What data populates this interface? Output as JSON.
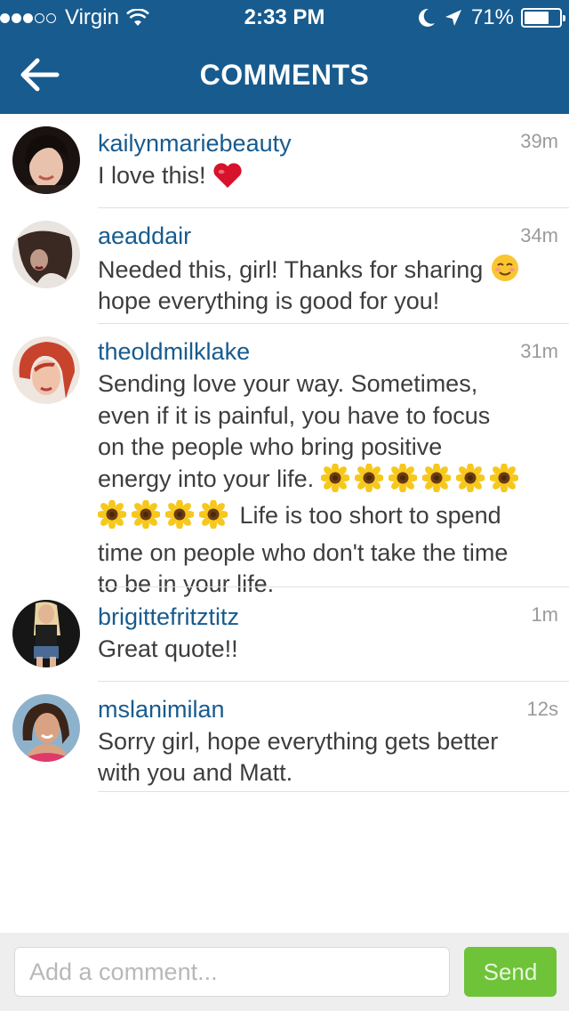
{
  "status_bar": {
    "signal_full": 3,
    "signal_total": 5,
    "carrier": "Virgin",
    "time": "2:33 PM",
    "battery": "71%",
    "battery_level": 0.71
  },
  "header": {
    "title": "COMMENTS"
  },
  "comments": [
    {
      "username": "kailynmariebeauty",
      "time": "39m",
      "lines": [
        "I love this!"
      ],
      "trailing_emoji": "heart-emoji"
    },
    {
      "username": "aeaddair",
      "time": "34m",
      "line1": "Needed this, girl! Thanks for sharing",
      "line1_emoji": "smiling-face-emoji",
      "line2": "hope everything is good for you!"
    },
    {
      "username": "theoldmilklake",
      "time": "31m",
      "line1": "Sending love your way. Sometimes,",
      "line2": "even if it is painful, you have to focus",
      "line3": "on the people who bring positive",
      "line4": "energy into your life.",
      "line5": "Life is too short to spend",
      "line6": "time on people who don't take the time",
      "line7": "to be in your life.",
      "emoji": "sunflower-emoji"
    },
    {
      "username": "brigittefritztitz",
      "time": "1m",
      "line1": "Great quote!!"
    },
    {
      "username": "mslanimilan",
      "time": "12s",
      "line1": "Sorry girl, hope everything gets better",
      "line2": "with you and Matt."
    }
  ],
  "footer": {
    "placeholder": "Add a comment...",
    "send_label": "Send"
  },
  "colors": {
    "header": "#185b8e",
    "username": "#175b8e",
    "send_button": "#6ec339"
  }
}
